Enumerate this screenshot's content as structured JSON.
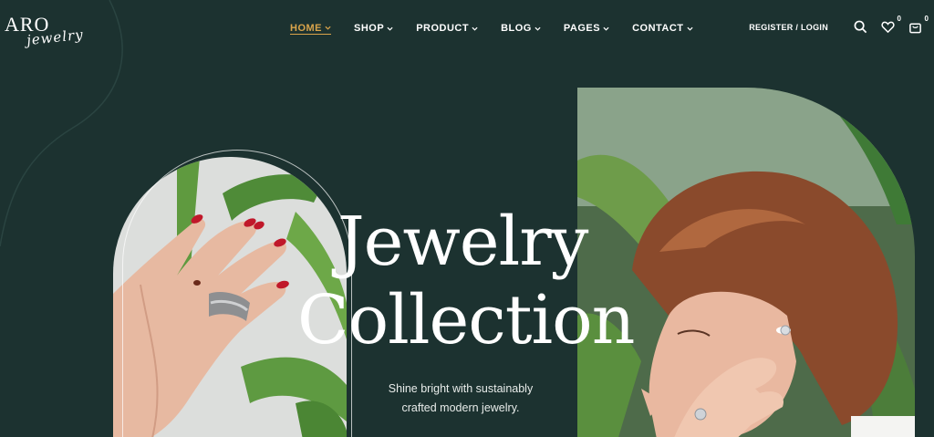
{
  "brand": {
    "name": "ARO",
    "sub": "jewelry"
  },
  "nav": {
    "items": [
      {
        "label": "HOME",
        "active": true
      },
      {
        "label": "SHOP",
        "active": false
      },
      {
        "label": "PRODUCT",
        "active": false
      },
      {
        "label": "BLOG",
        "active": false
      },
      {
        "label": "PAGES",
        "active": false
      },
      {
        "label": "CONTACT",
        "active": false
      }
    ]
  },
  "account": {
    "register_login": "REGISTER / LOGIN"
  },
  "wishlist": {
    "count": "0"
  },
  "cart": {
    "count": "0"
  },
  "hero": {
    "title_line1": "Jewelry",
    "title_line2": "Collection",
    "tagline_line1": "Shine bright with sustainably",
    "tagline_line2": "crafted modern jewelry."
  },
  "colors": {
    "background": "#1c3230",
    "accent": "#d9a44b",
    "text": "#ffffff"
  }
}
